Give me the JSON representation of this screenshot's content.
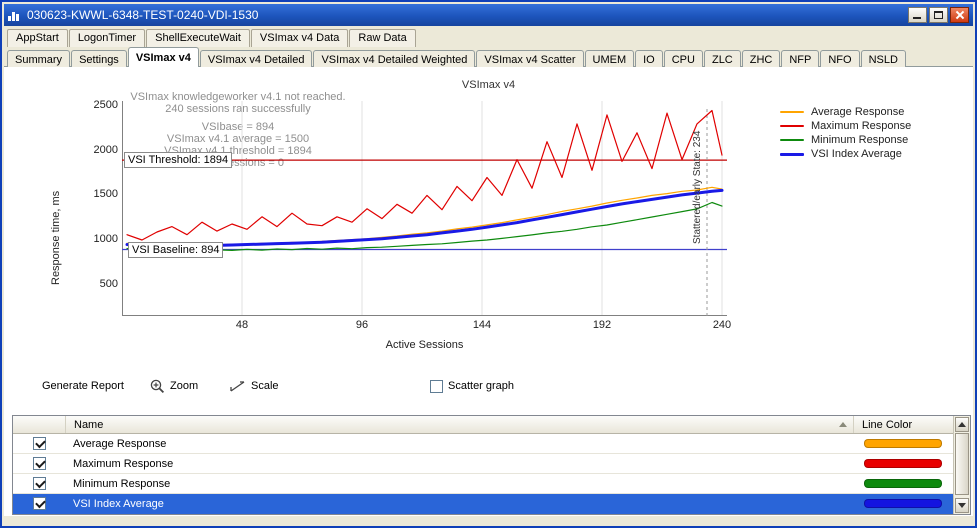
{
  "window": {
    "title": "030623-KWWL-6348-TEST-0240-VDI-1530"
  },
  "tabs_top": [
    "AppStart",
    "LogonTimer",
    "ShellExecuteWait",
    "VSImax v4 Data",
    "Raw Data"
  ],
  "tabs_main": [
    "Summary",
    "Settings",
    "VSImax v4",
    "VSImax v4 Detailed",
    "VSImax v4 Detailed Weighted",
    "VSImax v4 Scatter",
    "UMEM",
    "IO",
    "CPU",
    "ZLC",
    "ZHC",
    "NFP",
    "NFO",
    "NSLD"
  ],
  "active_tab": "VSImax v4",
  "toolbar": {
    "generate_report": "Generate Report",
    "zoom_label": "Zoom",
    "scale_label": "Scale",
    "scatter_label": "Scatter graph",
    "scatter_checked": false
  },
  "table": {
    "name_header": "Name",
    "line_color_header": "Line Color",
    "rows": [
      {
        "name": "Average Response",
        "checked": true,
        "color": "#ffa400",
        "selected": false
      },
      {
        "name": "Maximum Response",
        "checked": true,
        "color": "#e80000",
        "selected": false
      },
      {
        "name": "Minimum Response",
        "checked": true,
        "color": "#0e8a0e",
        "selected": false
      },
      {
        "name": "VSI Index Average",
        "checked": true,
        "color": "#1414e0",
        "selected": true
      }
    ]
  },
  "chart_data": {
    "type": "line",
    "title": "VSImax v4",
    "xlabel": "Active Sessions",
    "ylabel": "Response time, ms",
    "xlim": [
      0,
      242
    ],
    "ylim": [
      150,
      2500
    ],
    "x_ticks": [
      48,
      96,
      144,
      192,
      240
    ],
    "y_ticks": [
      500,
      1000,
      1500,
      2000,
      2500
    ],
    "grid": "vertical-only",
    "legend_position": "right",
    "annotations": [
      "VSImax knowledgeworker v4.1 not reached.",
      "240 sessions ran successfully",
      "",
      "VSIbase = 894",
      "VSImax v4.1 average = 1500",
      "VSImax v4.1 threshold = 1894",
      "Stuck sessions = 0"
    ],
    "threshold": {
      "value": 1894,
      "label": "VSI Threshold: 1894",
      "color": "#c00000"
    },
    "baseline": {
      "value": 894,
      "label": "VSI Baseline: 894",
      "color": "#4040cc"
    },
    "marker": {
      "x": 234,
      "label": "Stattered/early State: 234",
      "color": "#999999"
    },
    "x": [
      2,
      8,
      14,
      20,
      26,
      32,
      38,
      44,
      50,
      56,
      62,
      68,
      74,
      80,
      86,
      92,
      98,
      104,
      110,
      116,
      122,
      128,
      134,
      140,
      146,
      152,
      158,
      164,
      170,
      176,
      182,
      188,
      194,
      200,
      206,
      212,
      218,
      224,
      230,
      236,
      240
    ],
    "series": [
      {
        "name": "Average Response",
        "color": "#ffa400",
        "width": 1.2,
        "values": [
          965,
          940,
          935,
          945,
          940,
          950,
          945,
          955,
          950,
          965,
          960,
          975,
          970,
          985,
          995,
          1005,
          1015,
          1030,
          1045,
          1065,
          1080,
          1100,
          1125,
          1145,
          1170,
          1195,
          1225,
          1255,
          1285,
          1320,
          1350,
          1380,
          1415,
          1445,
          1470,
          1500,
          1520,
          1545,
          1560,
          1590,
          1570
        ]
      },
      {
        "name": "Maximum Response",
        "color": "#e00000",
        "width": 1.2,
        "values": [
          1060,
          1000,
          1090,
          1150,
          1060,
          1200,
          1100,
          1180,
          1120,
          1260,
          1150,
          1300,
          1180,
          1160,
          1260,
          1200,
          1350,
          1240,
          1400,
          1300,
          1500,
          1340,
          1600,
          1440,
          1700,
          1500,
          1900,
          1580,
          2100,
          1700,
          2300,
          1780,
          2400,
          1880,
          2200,
          1800,
          2420,
          1900,
          2300,
          2450,
          1950
        ]
      },
      {
        "name": "Minimum Response",
        "color": "#0e8a0e",
        "width": 1.2,
        "values": [
          905,
          880,
          870,
          880,
          890,
          878,
          890,
          884,
          895,
          888,
          900,
          893,
          905,
          898,
          910,
          903,
          915,
          920,
          930,
          940,
          950,
          958,
          972,
          988,
          1000,
          1018,
          1038,
          1058,
          1080,
          1098,
          1120,
          1148,
          1168,
          1198,
          1228,
          1258,
          1288,
          1318,
          1348,
          1420,
          1380
        ]
      },
      {
        "name": "VSI Index Average",
        "color": "#1a1ae6",
        "width": 3,
        "values": [
          950,
          930,
          920,
          925,
          930,
          935,
          940,
          945,
          950,
          955,
          960,
          965,
          970,
          975,
          985,
          995,
          1005,
          1015,
          1030,
          1045,
          1060,
          1080,
          1100,
          1120,
          1145,
          1170,
          1195,
          1225,
          1255,
          1285,
          1315,
          1345,
          1375,
          1405,
          1430,
          1455,
          1480,
          1505,
          1525,
          1545,
          1555
        ]
      }
    ]
  }
}
